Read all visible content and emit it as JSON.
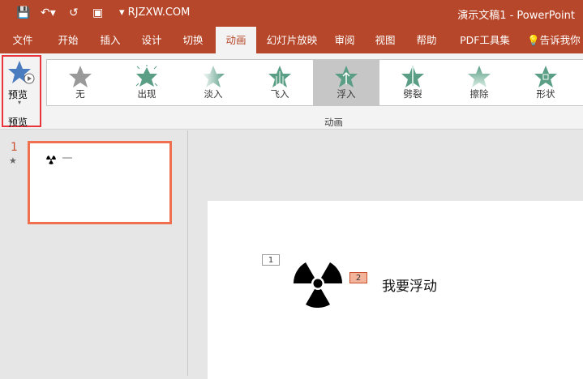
{
  "titlebar": {
    "site": "RJZXW.COM",
    "title": "演示文稿1  -  PowerPoint"
  },
  "tabs": [
    "文件",
    "开始",
    "插入",
    "设计",
    "切换",
    "动画",
    "幻灯片放映",
    "审阅",
    "视图",
    "帮助",
    "PDF工具集",
    "告诉我你"
  ],
  "ribbon": {
    "preview_label": "预览",
    "preview_group": "预览",
    "animation_group": "动画",
    "effects": [
      {
        "label": "无"
      },
      {
        "label": "出现"
      },
      {
        "label": "淡入"
      },
      {
        "label": "飞入"
      },
      {
        "label": "浮入"
      },
      {
        "label": "劈裂"
      },
      {
        "label": "擦除"
      },
      {
        "label": "形状"
      }
    ]
  },
  "slides_panel": {
    "slide_number": "1"
  },
  "slide": {
    "tag1": "1",
    "tag2": "2",
    "text": "我要浮动"
  },
  "colors": {
    "accent": "#b7472a",
    "selected_border": "#ef6f4f",
    "effect_green": "#5a9e86"
  }
}
